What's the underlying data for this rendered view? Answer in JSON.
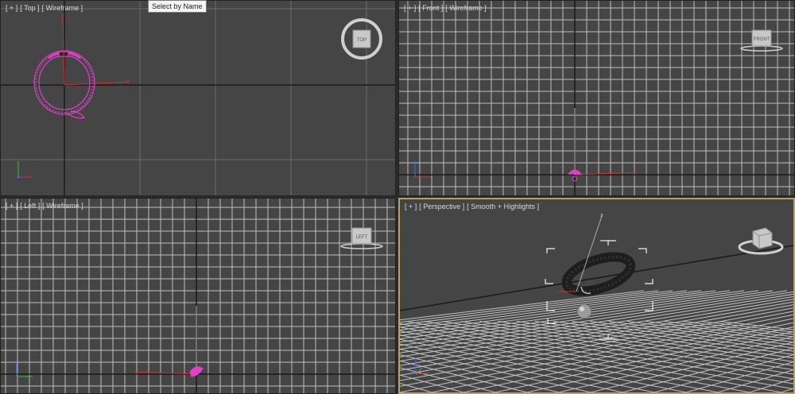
{
  "tooltip": {
    "text": "Select by Name"
  },
  "viewports": {
    "top": {
      "plus": "[ + ]",
      "view": "[ Top ]",
      "mode": "[ Wireframe ]",
      "cube": "TOP"
    },
    "front": {
      "plus": "[ + ]",
      "view": "[ Front ]",
      "mode": "[ Wireframe ]",
      "cube": "FRONT"
    },
    "left": {
      "plus": "[ + ]",
      "view": "[ Left ]",
      "mode": "[ Wireframe ]",
      "cube": "LEFT"
    },
    "perspective": {
      "plus": "[ + ]",
      "view": "[ Perspective ]",
      "mode": "[ Smooth + Highlights ]"
    }
  },
  "axis_letters": {
    "x": "x",
    "y": "y",
    "z": "z"
  },
  "colors": {
    "selected_wire": "#e040c8",
    "active_border": "#b7a260",
    "grid": "#b8b8b8",
    "axis_red": "#d03030"
  }
}
